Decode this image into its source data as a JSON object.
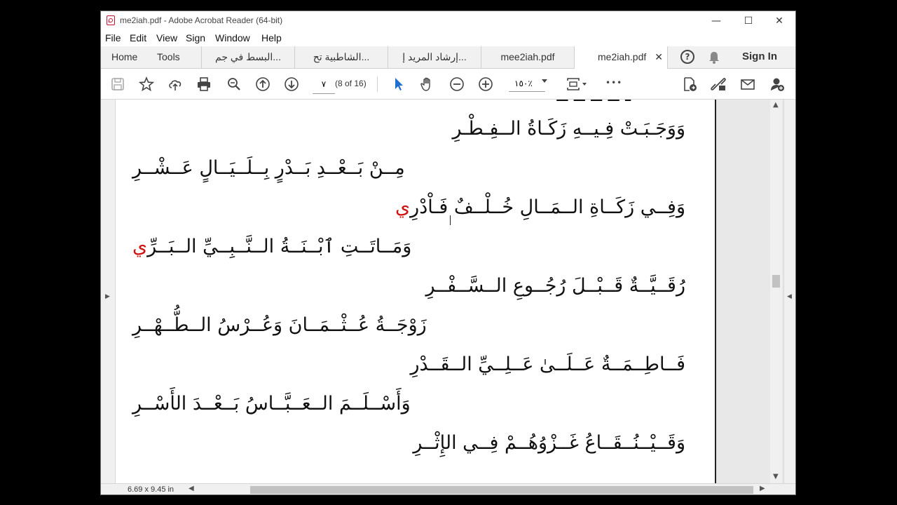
{
  "window": {
    "title": "me2iah.pdf - Adobe Acrobat Reader (64-bit)",
    "minimize": "—",
    "maximize": "☐",
    "close": "✕"
  },
  "menu": [
    "File",
    "Edit",
    "View",
    "Sign",
    "Window",
    "Help"
  ],
  "tabs": {
    "home": "Home",
    "tools": "Tools",
    "documents": [
      {
        "label": "البسط في جم...",
        "active": false
      },
      {
        "label": "الشاطبية تح...",
        "active": false
      },
      {
        "label": "إرشاد المريد إ...",
        "active": false
      },
      {
        "label": "mee2iah.pdf",
        "active": false
      },
      {
        "label": "me2iah.pdf",
        "active": true
      }
    ],
    "close_glyph": "✕",
    "help": "?",
    "sign_in": "Sign In"
  },
  "toolbar": {
    "page_number": "٧",
    "page_of": "(8 of 16)",
    "zoom": "١٥٠٪",
    "more": "•••"
  },
  "page": {
    "verses": [
      {
        "text": "وَوَجَـبَـتْ فِـيــهِ زَكَـاةُ الــفِـطْـرِ",
        "red": "",
        "align": "right"
      },
      {
        "text": "مِــنْ بَــعْــدِ بَــدْرٍ بِــلَــيَــالٍ عَــشْــرِ",
        "red": "",
        "align": "left"
      },
      {
        "text": "وَفِــي زَكَــاةِ الــمَــالِ خُــلْــفٌ فَـاْدْرِ",
        "red": "ي",
        "align": "right"
      },
      {
        "text": "وَمَــاتَــتِ ٱبْــنَــةُ الــنَّــبِــيِّ الــبَــرِّ",
        "red": "ي",
        "align": "left"
      },
      {
        "text": "رُقَــيَّــةٌ قَــبْــلَ رُجُــوعِ الــسَّــفْــرِ",
        "red": "",
        "align": "right"
      },
      {
        "text": "زَوْجَــةُ عُــثْــمَــانَ وَعُــرْسُ الــطُّــهْــرِ",
        "red": "",
        "align": "left"
      },
      {
        "text": "فَــاطِــمَــةٌ عَــلَــىٰ عَــلِــيِّ الــقَــدْرِ",
        "red": "",
        "align": "right"
      },
      {
        "text": "وَأَسْــلَــمَ الــعَــبَّــاسُ بَــعْــدَ الأَسْــرِ",
        "red": "",
        "align": "left"
      },
      {
        "text": "وَقَــيْــنُــقَــاعُ غَــزْوُهُــمْ فِــي الإِثْــرِ",
        "red": "",
        "align": "right"
      }
    ]
  },
  "status": {
    "page_size": "6.69 x 9.45 in"
  }
}
